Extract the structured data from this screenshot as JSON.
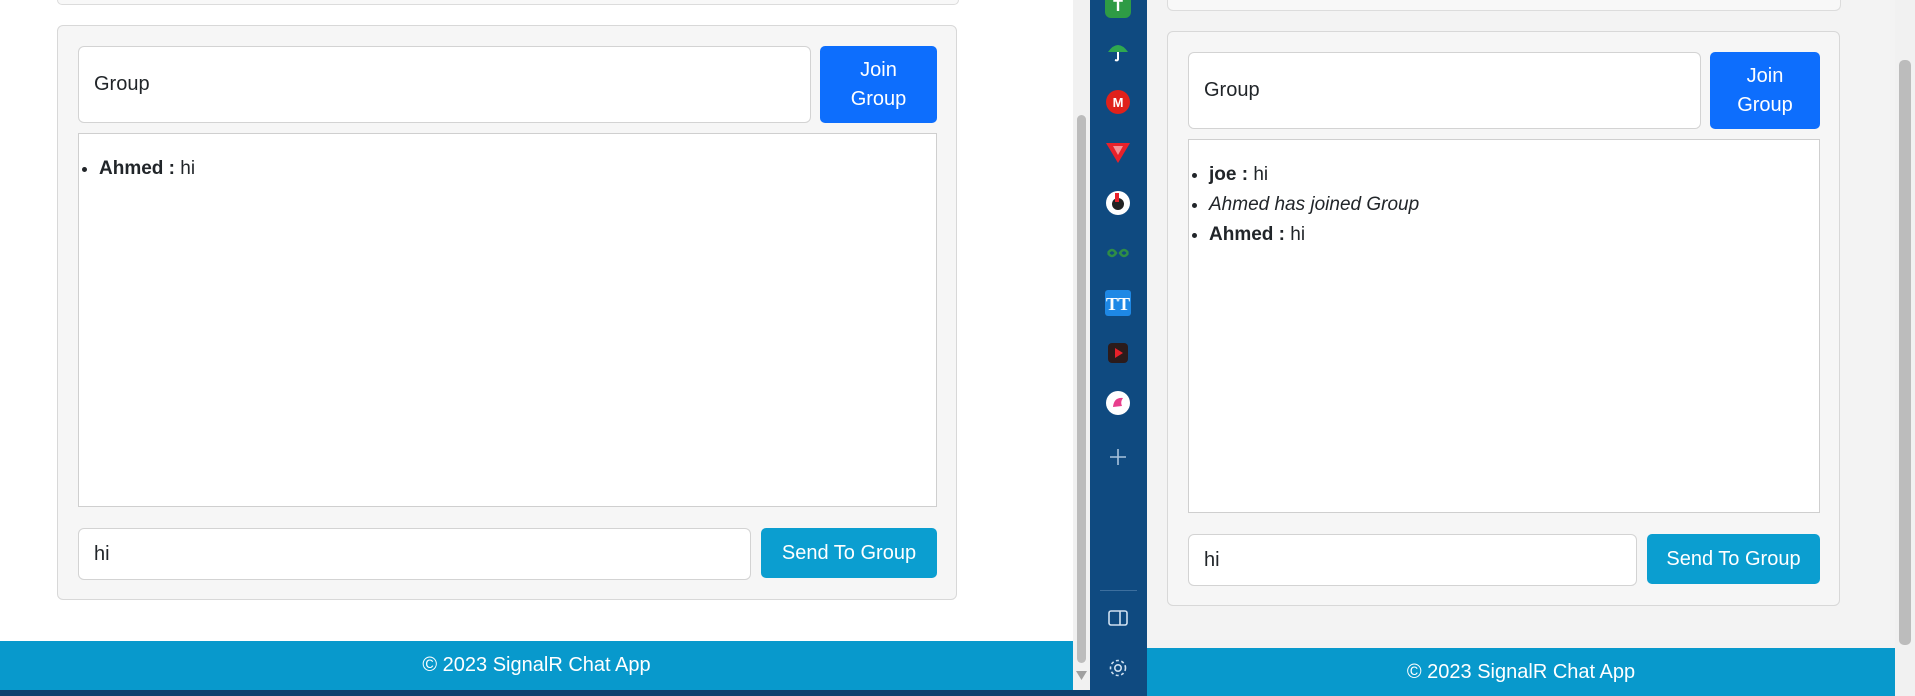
{
  "left_window": {
    "group_input": {
      "value": "Group",
      "placeholder": ""
    },
    "join_button": "Join Group",
    "messages": [
      {
        "type": "chat",
        "user": "Ahmed :",
        "text": "hi"
      }
    ],
    "message_input": {
      "value": "hi"
    },
    "send_button": "Send To Group",
    "footer": "© 2023 SignalR Chat App"
  },
  "right_window": {
    "group_input": {
      "value": "Group",
      "placeholder": ""
    },
    "join_button": "Join Group",
    "messages": [
      {
        "type": "chat",
        "user": "joe :",
        "text": "hi"
      },
      {
        "type": "system",
        "text": "Ahmed has joined Group"
      },
      {
        "type": "chat",
        "user": "Ahmed :",
        "text": "hi"
      }
    ],
    "message_input": {
      "value": "hi"
    },
    "send_button": "Send To Group",
    "footer": "© 2023 SignalR Chat App"
  },
  "sidebar": {
    "icons": [
      "app-icon",
      "umbrella-icon",
      "mail-icon",
      "vivaldi-icon",
      "game-icon",
      "geeksforgeeks-icon",
      "text-tool-icon",
      "media-icon",
      "chat-icon",
      "add-icon"
    ],
    "bottom_icons": [
      "panel-toggle-icon",
      "settings-icon"
    ]
  },
  "colors": {
    "primary": "#0d6efd",
    "info": "#0b9ed0",
    "footer": "#0899cc",
    "sidebar": "#0f4a80"
  }
}
